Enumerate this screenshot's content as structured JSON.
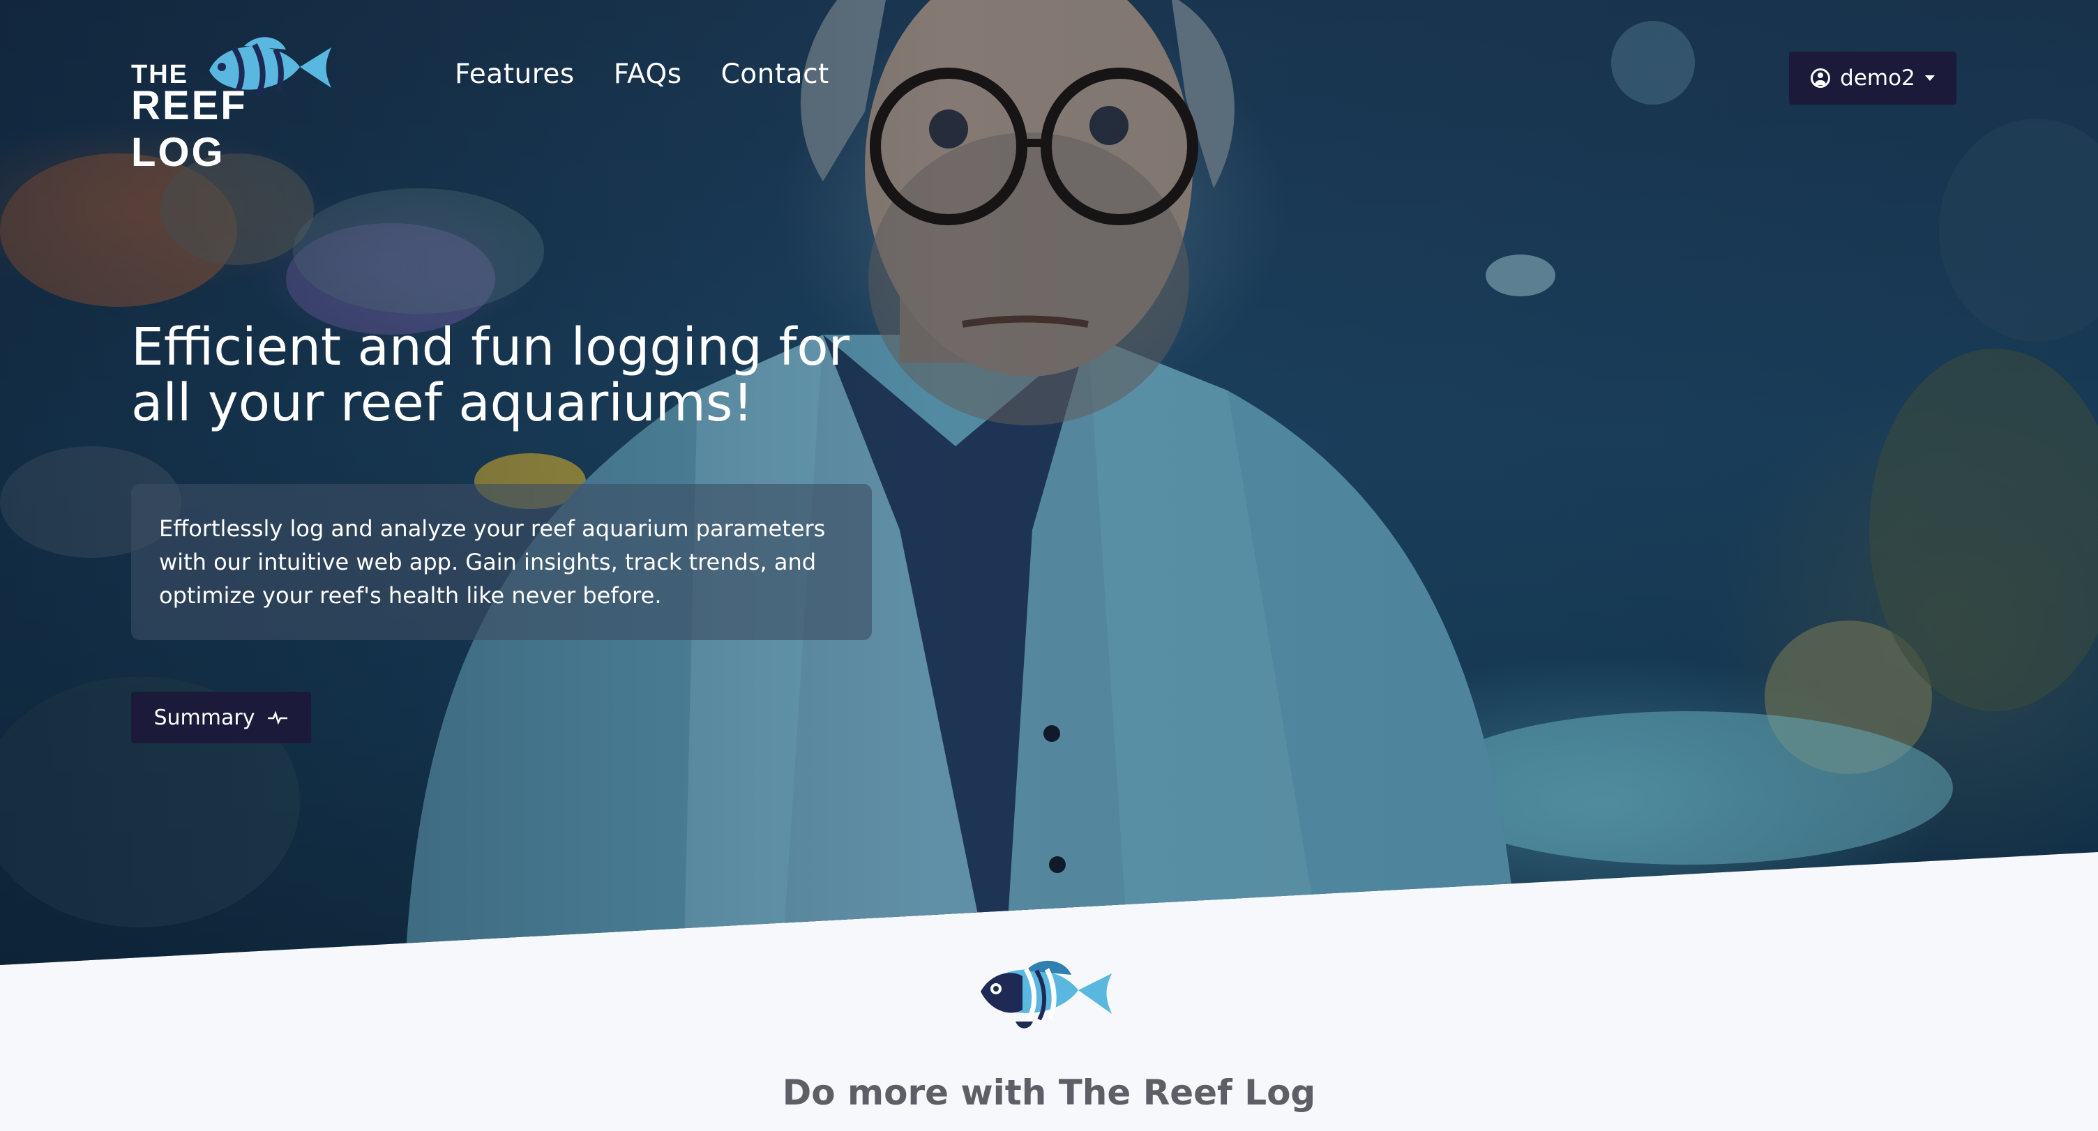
{
  "logo": {
    "line1": "THE",
    "line2": "REEF LOG",
    "icon": "fish-icon"
  },
  "nav": {
    "items": [
      "Features",
      "FAQs",
      "Contact"
    ]
  },
  "user_menu": {
    "username": "demo2",
    "icon": "user-circle-icon",
    "caret": "caret-down-icon"
  },
  "hero": {
    "headline_line1": "Efficient and fun logging for",
    "headline_line2": "all your reef aquariums!",
    "description_line1": "Effortlessly log and analyze your reef aquarium parameters",
    "description_line2": "with our intuitive web app. Gain insights, track trends, and",
    "description_line3": "optimize your reef's health like never before.",
    "cta_label": "Summary",
    "cta_icon": "pulse-icon"
  },
  "section": {
    "icon": "fish-icon",
    "title": "Do more with The Reef Log"
  },
  "colors": {
    "button_bg": "#1b1a3a",
    "fish_light": "#5ab8e0",
    "fish_dark": "#1e2a55",
    "section_bg": "#f7f8fb",
    "section_text": "#5e5f66"
  }
}
